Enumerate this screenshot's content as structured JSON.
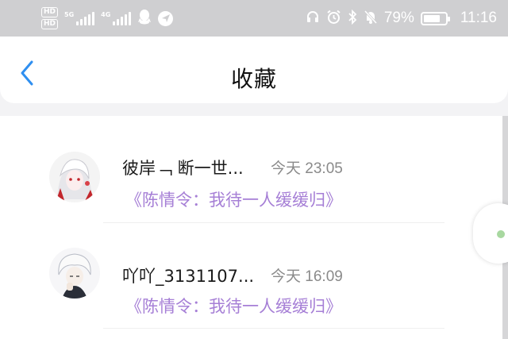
{
  "status_bar": {
    "hd1": "HD",
    "hd2": "HD",
    "sim1_tag": "5G",
    "sim2_tag": "4G",
    "battery_percent": "79%",
    "battery_level": 0.79,
    "time": "11:16"
  },
  "nav": {
    "title": "收藏"
  },
  "favorites": [
    {
      "username": "彼岸﹁ 断一世...",
      "time": "今天 23:05",
      "title": "《陈情令：我待一人缓缓归》"
    },
    {
      "username": "吖吖_3131107...",
      "time": "今天 16:09",
      "title": "《陈情令：我待一人缓缓归》"
    }
  ],
  "colors": {
    "accent": "#2f8ff0",
    "link_purple": "#a67fd6",
    "status_bar_bg": "#cfcfd1"
  }
}
